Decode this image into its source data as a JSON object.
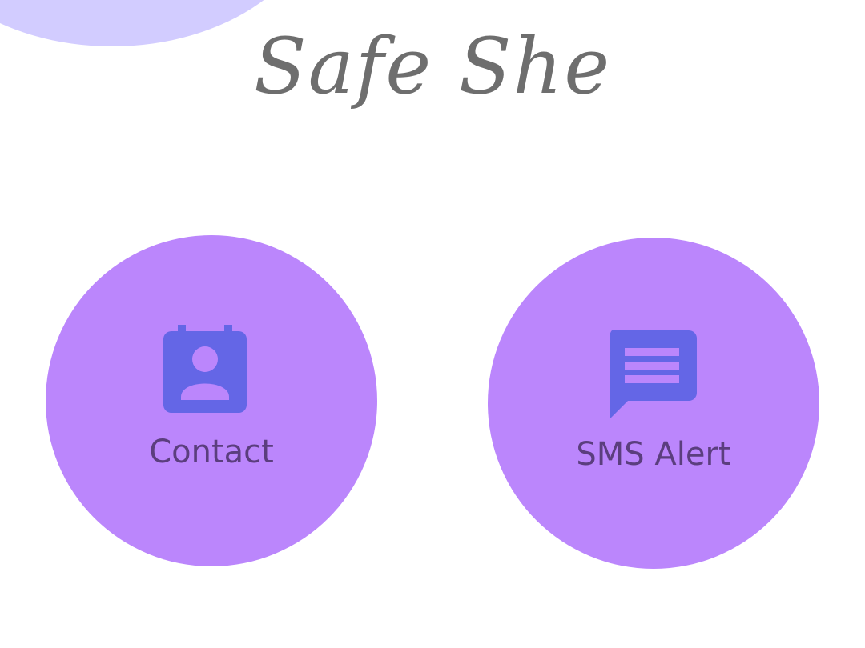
{
  "app": {
    "title": "Safe She"
  },
  "actions": [
    {
      "label": "Contact",
      "icon": "contact-card-icon"
    },
    {
      "label": "SMS Alert",
      "icon": "message-icon"
    }
  ],
  "colors": {
    "background": "#ffffff",
    "corner_blob": "#d2ccff",
    "circle": "#bb86fc",
    "icon": "#6466e6",
    "label": "#5b3e7e",
    "title": "#6e6e6e"
  }
}
